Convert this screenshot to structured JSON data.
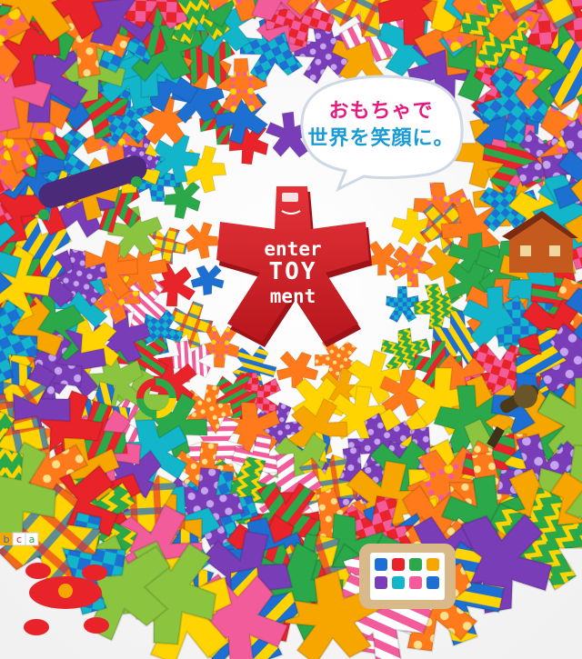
{
  "slogan": {
    "line1": "おもちゃで",
    "line2": "世界を笑顔に。"
  },
  "logo": {
    "line1": "enter",
    "line2": "TOY",
    "line3": "ment",
    "color": "#d8232a"
  },
  "block_letters": [
    "b",
    "c",
    "a"
  ],
  "palette": [
    "#e8232a",
    "#f7a600",
    "#2aa84a",
    "#1d6fd1",
    "#7a3db8",
    "#12b5c9",
    "#f25c9a",
    "#ffd400",
    "#ff7a1a",
    "#8bc53f"
  ]
}
